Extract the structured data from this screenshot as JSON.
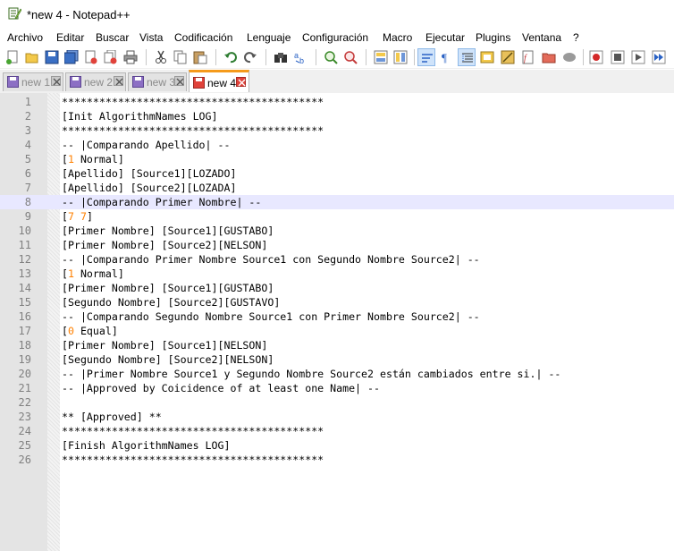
{
  "window": {
    "title": "*new 4 - Notepad++"
  },
  "menu": [
    "Archivo",
    "Editar",
    "Buscar",
    "Vista",
    "Codificación",
    "Lenguaje",
    "Configuración",
    "Macro",
    "Ejecutar",
    "Plugins",
    "Ventana",
    "?"
  ],
  "toolbar": {
    "buttons": [
      "new-file-icon",
      "open-file-icon",
      "save-icon",
      "save-all-icon",
      "close-icon",
      "close-all-icon",
      "print-icon",
      "cut-icon",
      "copy-icon",
      "paste-icon",
      "undo-icon",
      "redo-icon",
      "find-icon",
      "replace-icon",
      "zoom-in-icon",
      "zoom-out-icon",
      "sync-vertical-icon",
      "sync-horizontal-icon",
      "word-wrap-icon",
      "show-all-chars-icon",
      "indent-guide-icon",
      "doc-map-icon",
      "function-list-icon",
      "folder-workspace-icon",
      "monitoring-icon",
      "spell-icon",
      "record-macro-icon",
      "stop-record-icon",
      "play-macro-icon",
      "run-macro-multiple-icon"
    ]
  },
  "tabs": [
    {
      "label": "new 1",
      "active": false
    },
    {
      "label": "new 2",
      "active": false
    },
    {
      "label": "new 3",
      "active": false
    },
    {
      "label": "new 4",
      "active": true
    }
  ],
  "editor": {
    "current_line": 8,
    "lines": [
      {
        "n": "1",
        "text": "******************************************"
      },
      {
        "n": "2",
        "text": "[Init AlgorithmNames LOG]"
      },
      {
        "n": "3",
        "text": "******************************************"
      },
      {
        "n": "4",
        "text": "-- |Comparando Apellido| --"
      },
      {
        "n": "5",
        "text": "[1 Normal]"
      },
      {
        "n": "6",
        "text": "[Apellido] [Source1][LOZADO]"
      },
      {
        "n": "7",
        "text": "[Apellido] [Source2][LOZADA]"
      },
      {
        "n": "8",
        "text": "-- |Comparando Primer Nombre| --"
      },
      {
        "n": "9",
        "text": "[7 7]"
      },
      {
        "n": "10",
        "text": "[Primer Nombre] [Source1][GUSTABO]"
      },
      {
        "n": "11",
        "text": "[Primer Nombre] [Source2][NELSON]"
      },
      {
        "n": "12",
        "text": "-- |Comparando Primer Nombre Source1 con Segundo Nombre Source2| --"
      },
      {
        "n": "13",
        "text": "[1 Normal]"
      },
      {
        "n": "14",
        "text": "[Primer Nombre] [Source1][GUSTABO]"
      },
      {
        "n": "15",
        "text": "[Segundo Nombre] [Source2][GUSTAVO]"
      },
      {
        "n": "16",
        "text": "-- |Comparando Segundo Nombre Source1 con Primer Nombre Source2| --"
      },
      {
        "n": "17",
        "text": "[0 Equal]"
      },
      {
        "n": "18",
        "text": "[Primer Nombre] [Source1][NELSON]"
      },
      {
        "n": "19",
        "text": "[Segundo Nombre] [Source2][NELSON]"
      },
      {
        "n": "20",
        "text": "-- |Primer Nombre Source1 y Segundo Nombre Source2 están cambiados entre si.| --"
      },
      {
        "n": "21",
        "text": "-- |Approved by Coicidence of at least one Name| --"
      },
      {
        "n": "22",
        "text": ""
      },
      {
        "n": "23",
        "text": "** [Approved] **"
      },
      {
        "n": "24",
        "text": "******************************************"
      },
      {
        "n": "25",
        "text": "[Finish AlgorithmNames LOG]"
      },
      {
        "n": "26",
        "text": "******************************************"
      }
    ]
  },
  "colors": {
    "number": "#ff8000",
    "current_line": "#e8e8ff",
    "active_tab_accent": "#f59a1b",
    "gutter": "#e4e4e4"
  }
}
